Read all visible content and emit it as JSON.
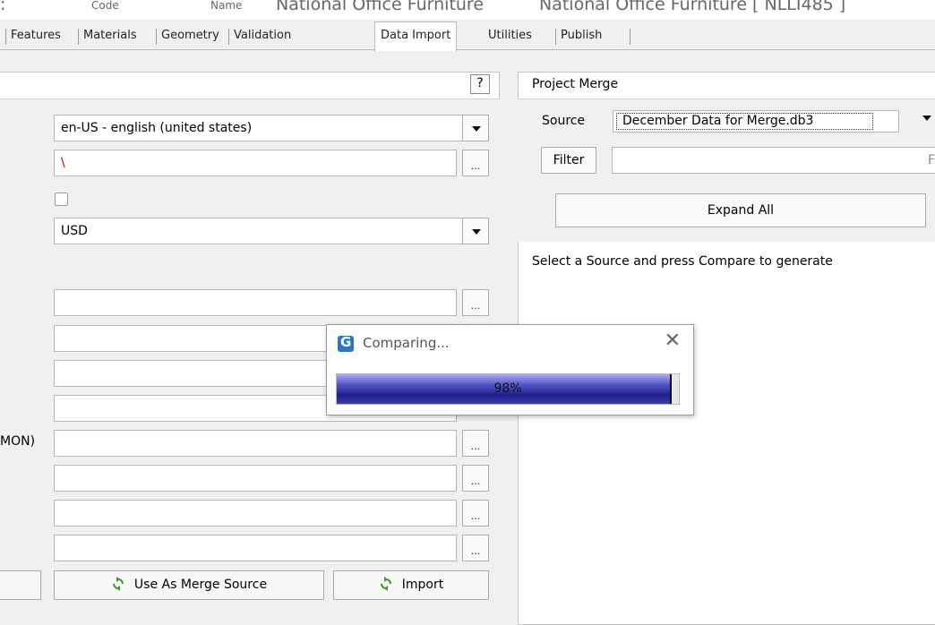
{
  "window": {
    "title_fragments": [
      "Code",
      "Name",
      "National Office Furniture",
      "National Office Furniture [ NLLI485 ]"
    ]
  },
  "tabs": [
    {
      "label": "Features"
    },
    {
      "label": "Materials"
    },
    {
      "label": "Geometry"
    },
    {
      "label": "Validation"
    },
    {
      "label": "Data Import",
      "active": true
    },
    {
      "label": "Utilities"
    },
    {
      "label": "Publish"
    }
  ],
  "left_panel": {
    "help_label": "?",
    "language_value": "en-US - english (united states)",
    "path_value": "\\",
    "currency_value": "USD",
    "side_label": "MON)",
    "dots_label": "...",
    "use_merge_label": "Use As Merge Source",
    "import_label": "Import",
    "colors": {
      "path_text": "#d40000"
    }
  },
  "right_panel": {
    "title": "Project Merge",
    "source_label": "Source",
    "source_value": "December Data for Merge.db3",
    "filter_label": "Filter",
    "filter_cut_char": "F",
    "expand_label": "Expand All",
    "message": "Select a Source and press Compare to generate"
  },
  "dialog": {
    "title": "Comparing...",
    "close_label": "✕",
    "progress_text": "98%",
    "progress_value": 0.98
  }
}
